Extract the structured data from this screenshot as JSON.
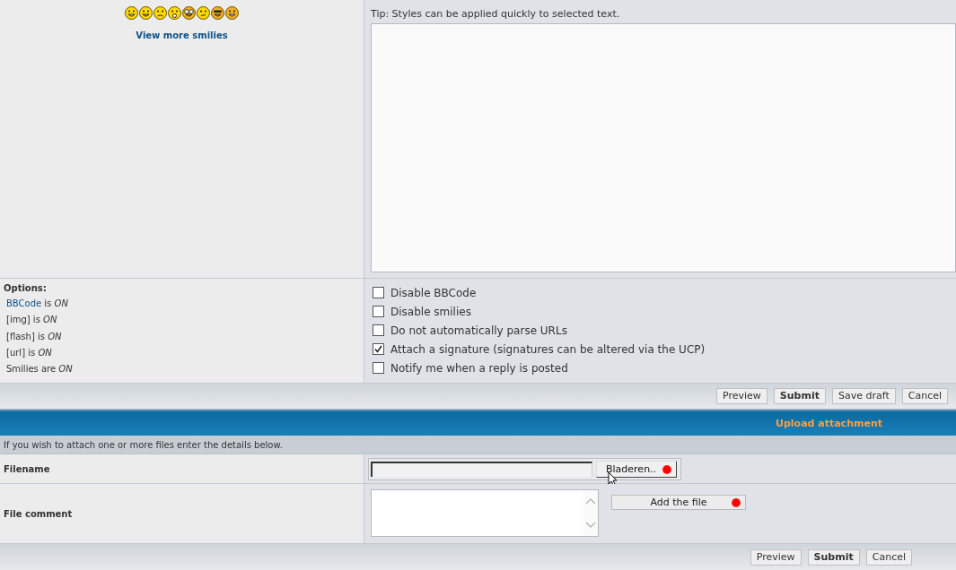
{
  "smilies": {
    "link": "View more smilies"
  },
  "editor": {
    "tip": "Tip: Styles can be applied quickly to selected text."
  },
  "options": {
    "title": "Options:",
    "items": [
      {
        "link": "BBCode",
        "text": "is *ON*"
      },
      {
        "text": "[img] is *ON*"
      },
      {
        "text": "[flash] is *ON*"
      },
      {
        "text": "[url] is *ON*"
      },
      {
        "text": "Smilies are *ON*"
      }
    ],
    "checkboxes": [
      {
        "label": "Disable BBCode",
        "checked": false
      },
      {
        "label": "Disable smilies",
        "checked": false
      },
      {
        "label": "Do not automatically parse URLs",
        "checked": false
      },
      {
        "label": "Attach a signature (signatures can be altered via the UCP)",
        "checked": true
      },
      {
        "label": "Notify me when a reply is posted",
        "checked": false
      }
    ]
  },
  "buttons": [
    {
      "label": "Preview",
      "primary": false
    },
    {
      "label": "Submit",
      "primary": true
    },
    {
      "label": "Save draft",
      "primary": false
    },
    {
      "label": "Cancel",
      "primary": false
    }
  ],
  "upload": {
    "title": "Upload attachment",
    "info": "If you wish to attach one or more files enter the details below.",
    "filename_label": "Filename",
    "browse": "Bladeren..",
    "comment_label": "File comment",
    "add": "Add the file"
  },
  "bottom_buttons": [
    {
      "label": "Preview",
      "primary": false
    },
    {
      "label": "Submit",
      "primary": true
    },
    {
      "label": "Cancel",
      "primary": false
    }
  ]
}
